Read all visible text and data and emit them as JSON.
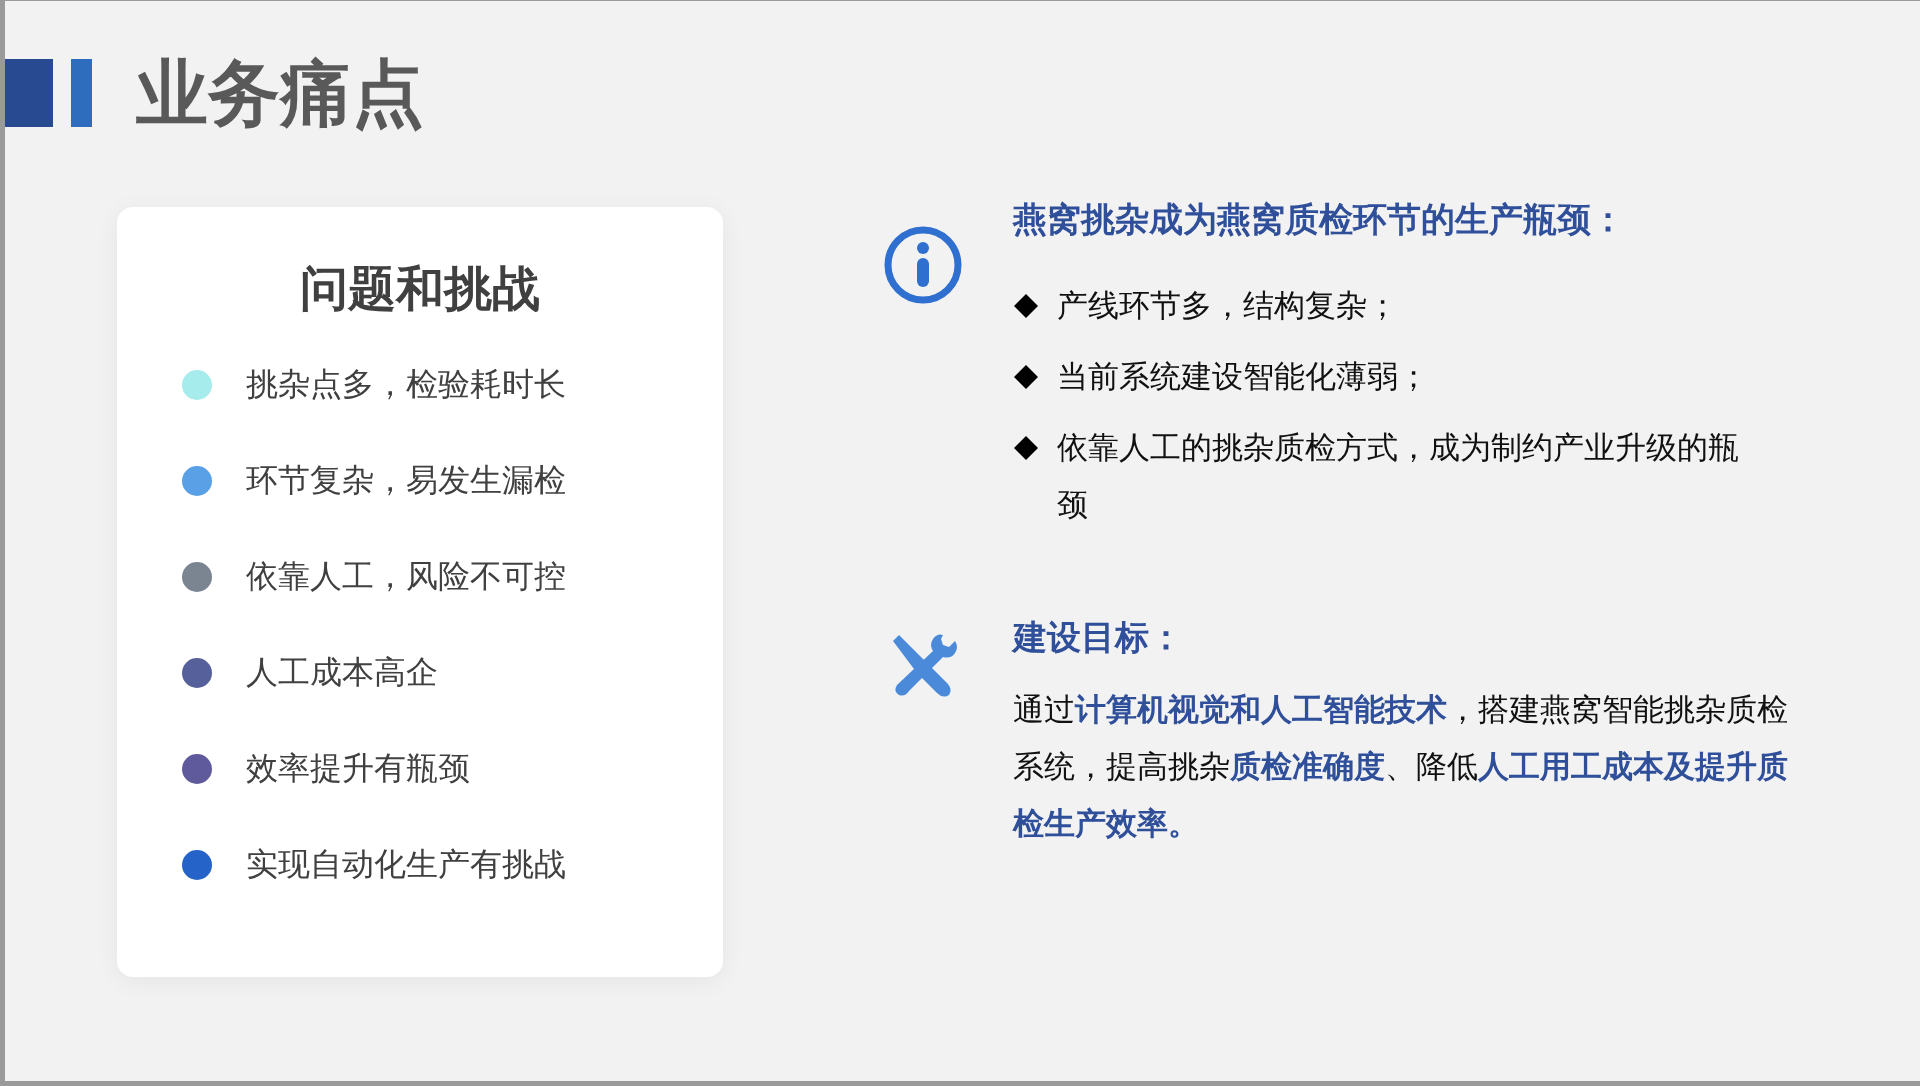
{
  "title": "业务痛点",
  "challenges": {
    "heading": "问题和挑战",
    "items": [
      {
        "text": "挑杂点多，检验耗时长",
        "color": "#a6ecec"
      },
      {
        "text": "环节复杂，易发生漏检",
        "color": "#5aa0e6"
      },
      {
        "text": "依靠人工，风险不可控",
        "color": "#7b8591"
      },
      {
        "text": "人工成本高企",
        "color": "#56609a"
      },
      {
        "text": "效率提升有瓶颈",
        "color": "#5f5a9c"
      },
      {
        "text": "实现自动化生产有挑战",
        "color": "#2563c8"
      }
    ]
  },
  "bottleneck": {
    "heading": "燕窝挑杂成为燕窝质检环节的生产瓶颈：",
    "bullets": [
      "产线环节多，结构复杂；",
      "当前系统建设智能化薄弱；",
      "依靠人工的挑杂质检方式，成为制约产业升级的瓶颈"
    ]
  },
  "goal": {
    "heading": "建设目标：",
    "text": "通过**计算机视觉和人工智能技术**，搭建燕窝智能挑杂质检系统，提高挑杂**质检准确度**、降低**人工用工成本及提升质检生产效率。**"
  }
}
